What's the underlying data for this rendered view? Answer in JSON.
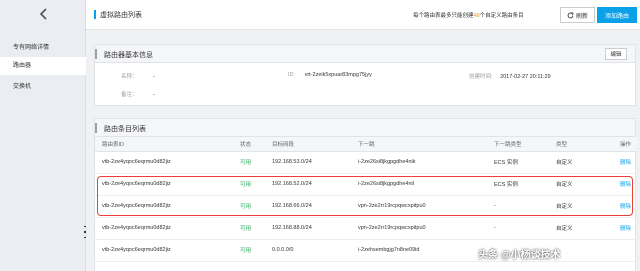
{
  "sidebar": {
    "items": [
      {
        "label": "专有网络详情"
      },
      {
        "label": "路由器"
      },
      {
        "label": "交换机"
      }
    ]
  },
  "header": {
    "title": "虚拟路由列表",
    "limit_prefix": "每个路由表最多只能创建",
    "limit_count": "48",
    "limit_suffix": "个自定义路由条目",
    "refresh_label": "刷新",
    "add_label": "添加路由"
  },
  "basic_info": {
    "title": "路由器基本信息",
    "edit_label": "编辑",
    "name_label": "名称：",
    "name_value": "-",
    "id_label": "ID:",
    "id_value": "vrt-2zeik5xpuar83mpg75jyy",
    "created_label": "创建时间:",
    "created_value": "2017-02-27 20:11:29",
    "note_label": "备注：",
    "note_value": "-"
  },
  "route_table": {
    "title": "路由条目列表",
    "columns": [
      "路由表ID",
      "状态",
      "目标网段",
      "下一跳",
      "下一跳类型",
      "类型",
      "操作"
    ],
    "rows": [
      [
        "vtb-2ze4yqoc6eqrmu0d82jiz",
        "可用",
        "192.168.53.0/24",
        "i-2ze26si8jkgpgdhe4nik",
        "ECS 实例",
        "自定义",
        "删除"
      ],
      [
        "vtb-2ze4yqoc6eqrmu0d82jiz",
        "可用",
        "192.168.52.0/24",
        "i-2ze26si8jkgpgdhe4nil",
        "ECS 实例",
        "自定义",
        "删除"
      ],
      [
        "vtb-2ze4yqoc6eqrmu0d82jiz",
        "可用",
        "192.168.66.0/24",
        "vpn-2ze2rr19rcpqwcxpitpu0",
        "-",
        "自定义",
        "删除"
      ],
      [
        "vtb-2ze4yqoc6eqrmu0d82jiz",
        "可用",
        "192.168.88.0/24",
        "vpn-2ze2rr19rcpqwcxpitpu0",
        "-",
        "自定义",
        "删除"
      ],
      [
        "vtb-2ze4yqoc6eqrmu0d82jiz",
        "可用",
        "0.0.0.0/0",
        "i-2zehsembgjg7n8ne09id",
        "",
        "",
        ""
      ]
    ]
  },
  "watermark": "头条 @小杨谈技术",
  "colors": {
    "accent": "#0aa1e8",
    "available": "#2dab5f",
    "highlight": "#ea3f36",
    "limit_number": "#f39800"
  }
}
